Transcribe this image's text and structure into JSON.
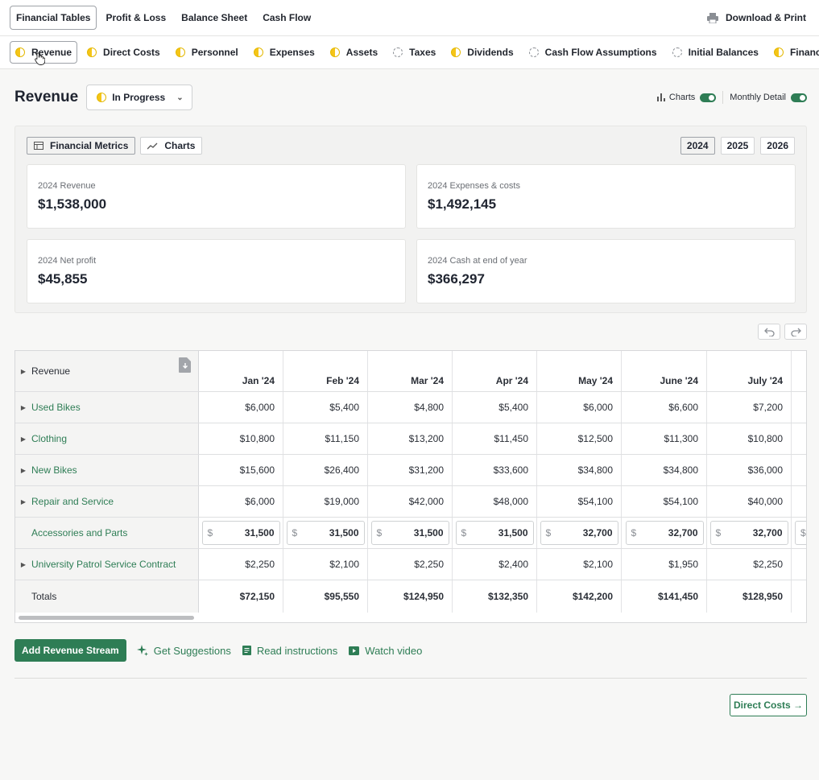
{
  "topnav": {
    "tabs": [
      "Financial Tables",
      "Profit & Loss",
      "Balance Sheet",
      "Cash Flow"
    ],
    "download_label": "Download & Print"
  },
  "subnav": {
    "items": [
      {
        "label": "Revenue",
        "status": "half"
      },
      {
        "label": "Direct Costs",
        "status": "half"
      },
      {
        "label": "Personnel",
        "status": "half"
      },
      {
        "label": "Expenses",
        "status": "half"
      },
      {
        "label": "Assets",
        "status": "half"
      },
      {
        "label": "Taxes",
        "status": "empty"
      },
      {
        "label": "Dividends",
        "status": "half"
      },
      {
        "label": "Cash Flow Assumptions",
        "status": "empty"
      },
      {
        "label": "Initial Balances",
        "status": "empty"
      },
      {
        "label": "Financing",
        "status": "half"
      }
    ]
  },
  "header": {
    "title": "Revenue",
    "status_label": "In Progress",
    "charts_toggle_label": "Charts",
    "monthly_toggle_label": "Monthly Detail"
  },
  "metrics": {
    "tabs": [
      "Financial Metrics",
      "Charts"
    ],
    "years": [
      "2024",
      "2025",
      "2026"
    ],
    "cards": [
      {
        "label": "2024 Revenue",
        "value": "$1,538,000"
      },
      {
        "label": "2024 Expenses & costs",
        "value": "$1,492,145"
      },
      {
        "label": "2024 Net profit",
        "value": "$45,855"
      },
      {
        "label": "2024 Cash at end of year",
        "value": "$366,297"
      }
    ]
  },
  "table": {
    "header_label": "Revenue",
    "months": [
      "Jan '24",
      "Feb '24",
      "Mar '24",
      "Apr '24",
      "May '24",
      "June '24",
      "July '24"
    ],
    "rows": [
      {
        "name": "Used Bikes",
        "values": [
          "$6,000",
          "$5,400",
          "$4,800",
          "$5,400",
          "$6,000",
          "$6,600",
          "$7,200"
        ]
      },
      {
        "name": "Clothing",
        "values": [
          "$10,800",
          "$11,150",
          "$13,200",
          "$11,450",
          "$12,500",
          "$11,300",
          "$10,800"
        ]
      },
      {
        "name": "New Bikes",
        "values": [
          "$15,600",
          "$26,400",
          "$31,200",
          "$33,600",
          "$34,800",
          "$34,800",
          "$36,000"
        ]
      },
      {
        "name": "Repair and Service",
        "values": [
          "$6,000",
          "$19,000",
          "$42,000",
          "$48,000",
          "$54,100",
          "$54,100",
          "$40,000"
        ]
      },
      {
        "name": "Accessories and Parts",
        "input_prefix": "$",
        "values": [
          "31,500",
          "31,500",
          "31,500",
          "31,500",
          "32,700",
          "32,700",
          "32,700"
        ]
      },
      {
        "name": "University Patrol Service Contract",
        "values": [
          "$2,250",
          "$2,100",
          "$2,250",
          "$2,400",
          "$2,100",
          "$1,950",
          "$2,250"
        ]
      }
    ],
    "totals_label": "Totals",
    "totals": [
      "$72,150",
      "$95,550",
      "$124,950",
      "$132,350",
      "$142,200",
      "$141,450",
      "$128,950"
    ]
  },
  "actions": {
    "add_label": "Add Revenue Stream",
    "suggest_label": "Get Suggestions",
    "read_label": "Read instructions",
    "video_label": "Watch video",
    "next_label": "Direct Costs →"
  }
}
